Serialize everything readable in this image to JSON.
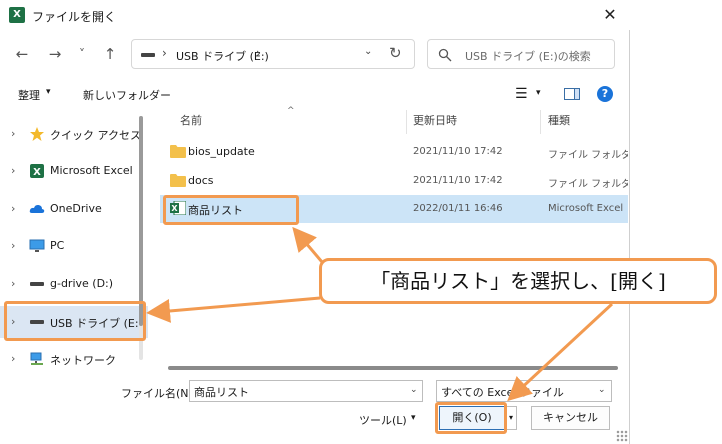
{
  "window": {
    "title": "ファイルを開く",
    "close_symbol": "✕",
    "app_icon_letter": "X"
  },
  "nav": {
    "back_symbol": "←",
    "forward_symbol": "→",
    "recent_symbol": "˅",
    "up_symbol": "↑",
    "address_text": "USB ドライブ (E:)",
    "address_separator": "›",
    "address_dropdown_symbol": "⌄",
    "refresh_symbol": "↻",
    "search_placeholder": "USB ドライブ (E:)の検索"
  },
  "cmdbar": {
    "organize": "整理",
    "organize_caret": "▾",
    "new_folder": "新しいフォルダー",
    "view_symbol": "☰",
    "view_caret": "▾",
    "help_symbol": "?"
  },
  "sidebar": {
    "chevron": "›",
    "items": [
      {
        "label": "クイック アクセス",
        "icon": "star-icon"
      },
      {
        "label": "Microsoft Excel",
        "icon": "excel-icon"
      },
      {
        "label": "OneDrive",
        "icon": "cloud-icon"
      },
      {
        "label": "PC",
        "icon": "monitor-icon"
      },
      {
        "label": "g-drive (D:)",
        "icon": "drive-icon"
      },
      {
        "label": "USB ドライブ (E:)",
        "icon": "drive-icon",
        "selected": true
      },
      {
        "label": "ネットワーク",
        "icon": "network-icon"
      }
    ]
  },
  "filelist": {
    "columns": {
      "name": "名前",
      "date": "更新日時",
      "type": "種類",
      "sort_caret": "^"
    },
    "rows": [
      {
        "name": "bios_update",
        "date": "2021/11/10 17:42",
        "type": "ファイル フォルダー",
        "icon": "folder-icon"
      },
      {
        "name": "docs",
        "date": "2021/11/10 17:42",
        "type": "ファイル フォルダー",
        "icon": "folder-icon"
      },
      {
        "name": "商品リスト",
        "date": "2022/01/11 16:46",
        "type": "Microsoft Excel",
        "icon": "excel-file-icon",
        "selected": true
      }
    ]
  },
  "bottom": {
    "filename_label": "ファイル名(N):",
    "filename_value": "商品リスト",
    "dropdown_caret": "⌄",
    "filter_value": "すべての Excel ファイル",
    "tools_label": "ツール(L)",
    "tools_caret": "▾",
    "open_label": "開く(O)",
    "open_split_caret": "▾",
    "cancel_label": "キャンセル"
  },
  "annotation": {
    "callout_text": "「商品リスト」を選択し、[開く]",
    "accent_color": "#f29a50"
  },
  "colors": {
    "selection": "#cce4f7",
    "sidebar_selection": "#dbe6f3",
    "excel_green": "#1e7145",
    "folder_yellow": "#f3c04b",
    "help_blue": "#1a73d9"
  }
}
